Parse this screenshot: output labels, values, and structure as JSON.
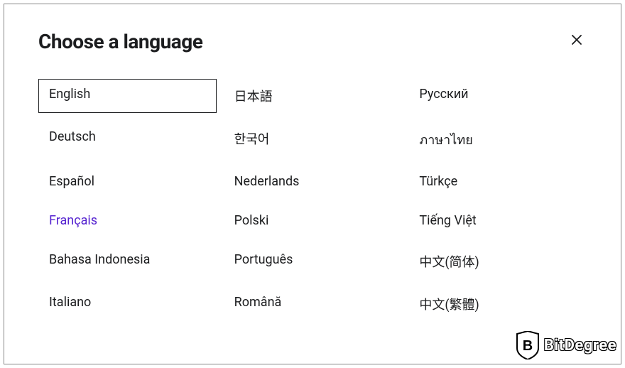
{
  "modal": {
    "title": "Choose a language",
    "close_label": "Close"
  },
  "languages": {
    "col1": [
      {
        "label": "English",
        "selected": true,
        "hovered": false
      },
      {
        "label": "Deutsch",
        "selected": false,
        "hovered": false
      },
      {
        "label": "Español",
        "selected": false,
        "hovered": false
      },
      {
        "label": "Français",
        "selected": false,
        "hovered": true
      },
      {
        "label": "Bahasa Indonesia",
        "selected": false,
        "hovered": false
      },
      {
        "label": "Italiano",
        "selected": false,
        "hovered": false
      }
    ],
    "col2": [
      {
        "label": "日本語",
        "selected": false,
        "hovered": false
      },
      {
        "label": "한국어",
        "selected": false,
        "hovered": false
      },
      {
        "label": "Nederlands",
        "selected": false,
        "hovered": false
      },
      {
        "label": "Polski",
        "selected": false,
        "hovered": false
      },
      {
        "label": "Português",
        "selected": false,
        "hovered": false
      },
      {
        "label": "Română",
        "selected": false,
        "hovered": false
      }
    ],
    "col3": [
      {
        "label": "Русский",
        "selected": false,
        "hovered": false
      },
      {
        "label": "ภาษาไทย",
        "selected": false,
        "hovered": false
      },
      {
        "label": "Türkçe",
        "selected": false,
        "hovered": false
      },
      {
        "label": "Tiếng Việt",
        "selected": false,
        "hovered": false
      },
      {
        "label": "中文(简体)",
        "selected": false,
        "hovered": false
      },
      {
        "label": "中文(繁體)",
        "selected": false,
        "hovered": false
      }
    ]
  },
  "watermark": {
    "text": "BitDegree",
    "badge_letter": "B"
  }
}
